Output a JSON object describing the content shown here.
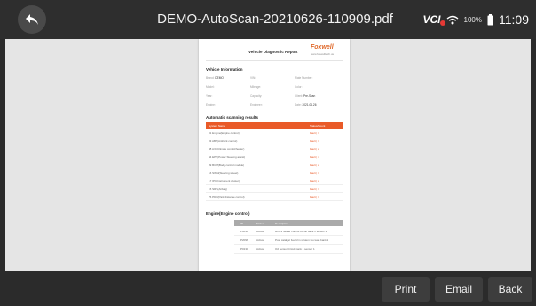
{
  "header": {
    "title": "DEMO-AutoScan-20210626-110909.pdf",
    "status": {
      "vci_label": "VCI",
      "battery_pct": "100%",
      "time": "11:09"
    }
  },
  "report": {
    "title": "Vehicle Diagnostic Report",
    "logo": "Foxwell",
    "logo_url": "www.foxwelltech.us",
    "vehicle_info": {
      "heading": "Vehicle Information",
      "fields": [
        {
          "label": "Brand:",
          "value": "DEMO"
        },
        {
          "label": "VIN:",
          "value": ""
        },
        {
          "label": "Plate Number:",
          "value": ""
        },
        {
          "label": "Model:",
          "value": ""
        },
        {
          "label": "Mileage:",
          "value": ""
        },
        {
          "label": "Color:",
          "value": ""
        },
        {
          "label": "Year:",
          "value": ""
        },
        {
          "label": "Capacity:",
          "value": ""
        },
        {
          "label": "Client:",
          "value": "Pre-Scan"
        },
        {
          "label": "Engine:",
          "value": ""
        },
        {
          "label": "Engineer:",
          "value": ""
        },
        {
          "label": "Date:",
          "value": "2021.06.26"
        }
      ]
    },
    "scan_results": {
      "heading": "Automatic scanning results",
      "col_system": "System Name",
      "col_status": "Status/Count",
      "rows": [
        {
          "system": "01 Engine(Engine control)",
          "status": "Fault | 3"
        },
        {
          "system": "03 ABS(Antilock control)",
          "status": "Fault | 1"
        },
        {
          "system": "08 A/C(Climate control/heater)",
          "status": "Fault | 2"
        },
        {
          "system": "44 EPS(Power Steering assist)",
          "status": "Fault | 4"
        },
        {
          "system": "09 BCM(Body control module)",
          "status": "Fault | 2"
        },
        {
          "system": "16 SWM(Steering wheel)",
          "status": "Fault | 1"
        },
        {
          "system": "17 IPC(Instrument cluster)",
          "status": "Fault | 2"
        },
        {
          "system": "15 SRS(Airbag)",
          "status": "Fault | 3"
        },
        {
          "system": "76 PDC(Park distance control)",
          "status": "Fault | 1"
        }
      ]
    },
    "engine": {
      "heading": "Engine(Engine control)",
      "cols": [
        "ID",
        "Status",
        "Description"
      ],
      "rows": [
        {
          "id": "P0030",
          "status": "Active",
          "desc": "HO2S heater control circuit bank 1 sensor 1"
        },
        {
          "id": "P2096",
          "status": "Active",
          "desc": "Post catalyst fuel trim system too lean bank 1"
        },
        {
          "id": "P0130",
          "status": "Active",
          "desc": "O2 sensor circuit bank 1 sensor 1"
        }
      ]
    }
  },
  "actions": {
    "print": "Print",
    "email": "Email",
    "back": "Back"
  },
  "colors": {
    "accent": "#e95a28",
    "background": "#2b2b2b",
    "viewer": "#e5e5e5"
  }
}
